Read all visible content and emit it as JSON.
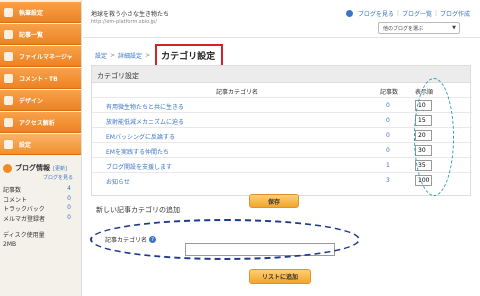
{
  "sidebar": {
    "items": [
      {
        "label": "執筆設定"
      },
      {
        "label": "記事一覧"
      },
      {
        "label": "ファイルマネージャ"
      },
      {
        "label": "コメント・TB"
      },
      {
        "label": "デザイン"
      },
      {
        "label": "アクセス解析"
      },
      {
        "label": "設定"
      }
    ],
    "info": {
      "title": "ブログ情報",
      "edit": "[更新]",
      "view_link": "ブログを見る",
      "stats": [
        {
          "label": "記事数",
          "value": "4"
        },
        {
          "label": "コメント",
          "value": "0"
        },
        {
          "label": "トラックバック",
          "value": "0"
        },
        {
          "label": "メルマガ登録者",
          "value": "0"
        }
      ],
      "disk_label": "ディスク使用量",
      "disk_value": "2MB"
    }
  },
  "header": {
    "blog_title": "地球を救う小さな生き物たち",
    "blog_url": "http://em-platform.sblo.jp/",
    "links": [
      "ブログを見る",
      "ブログ一覧",
      "ブログ作成"
    ],
    "select_value": "他のブログを選ぶ"
  },
  "breadcrumb": {
    "root": "設定",
    "parent": "詳細設定",
    "current": "カテゴリ設定"
  },
  "category_panel": {
    "title": "カテゴリ設定",
    "headers": [
      "記事カテゴリ名",
      "記事数",
      "表示順"
    ],
    "rows": [
      {
        "name": "有用微生物たちと共に生きる",
        "count": "0",
        "order": "10"
      },
      {
        "name": "放射能低減メカニズムに迫る",
        "count": "0",
        "order": "15"
      },
      {
        "name": "EMバッシングに反論する",
        "count": "0",
        "order": "20"
      },
      {
        "name": "EMを実践する仲間たち",
        "count": "0",
        "order": "30"
      },
      {
        "name": "ブログ開設を支援します",
        "count": "1",
        "order": "35"
      },
      {
        "name": "お知らせ",
        "count": "3",
        "order": "100"
      }
    ],
    "save_label": "保存"
  },
  "add_section": {
    "title": "新しい記事カテゴリの追加",
    "field_label": "記事カテゴリ名",
    "field_value": "",
    "add_button": "リストに追加"
  },
  "colors": {
    "nav_orange": "#ee8222",
    "link_blue": "#3a76c2",
    "highlight_red": "#d6202a",
    "annotation_navy": "#1d3b8a",
    "annotation_teal": "#2f9bb0"
  }
}
